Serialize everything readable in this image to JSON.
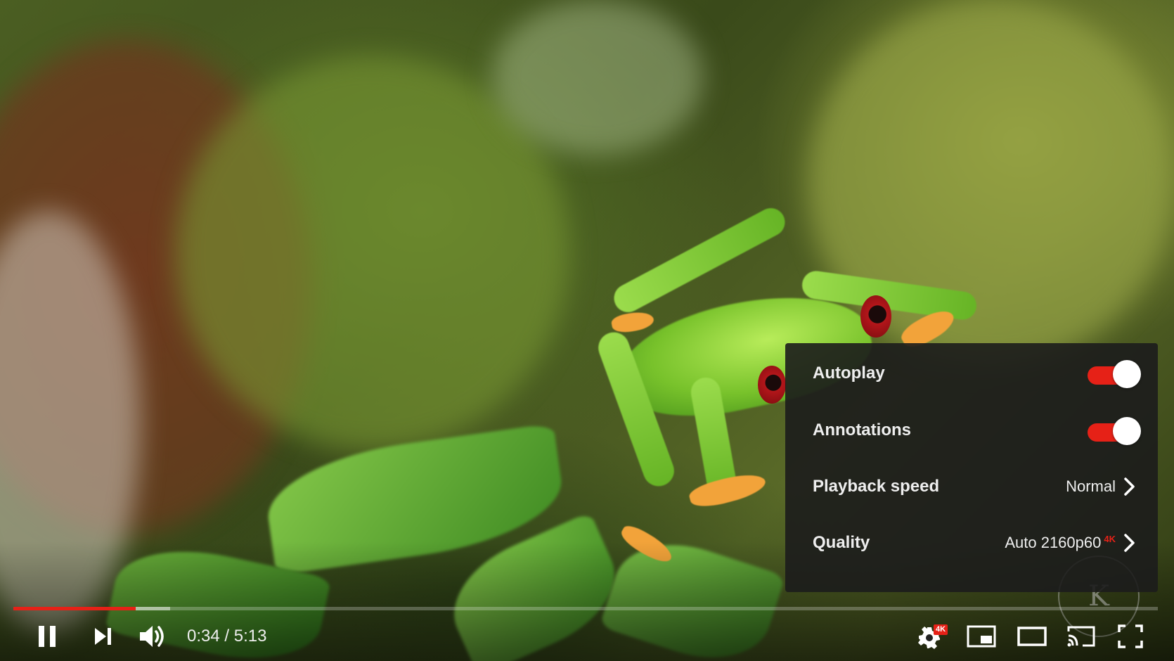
{
  "settings_menu": {
    "autoplay": {
      "label": "Autoplay",
      "on": true
    },
    "annotations": {
      "label": "Annotations",
      "on": true
    },
    "playback_speed": {
      "label": "Playback speed",
      "value": "Normal"
    },
    "quality": {
      "label": "Quality",
      "value": "Auto 2160p60",
      "badge": "4K"
    }
  },
  "player": {
    "current_time": "0:34",
    "separator": " / ",
    "duration": "5:13",
    "played_fraction": 0.107,
    "buffered_fraction": 0.137,
    "settings_badge": "4K"
  },
  "watermark": {
    "letters": "K"
  },
  "colors": {
    "accent": "#e62117",
    "menu_bg": "rgba(28,28,28,0.9)",
    "text": "#eeeeee"
  },
  "icons": {
    "play_pause": "pause-icon",
    "next": "next-icon",
    "volume": "volume-icon",
    "settings": "gear-icon",
    "miniplayer": "miniplayer-icon",
    "theater": "theater-mode-icon",
    "cast": "cast-icon",
    "fullscreen": "fullscreen-icon"
  }
}
